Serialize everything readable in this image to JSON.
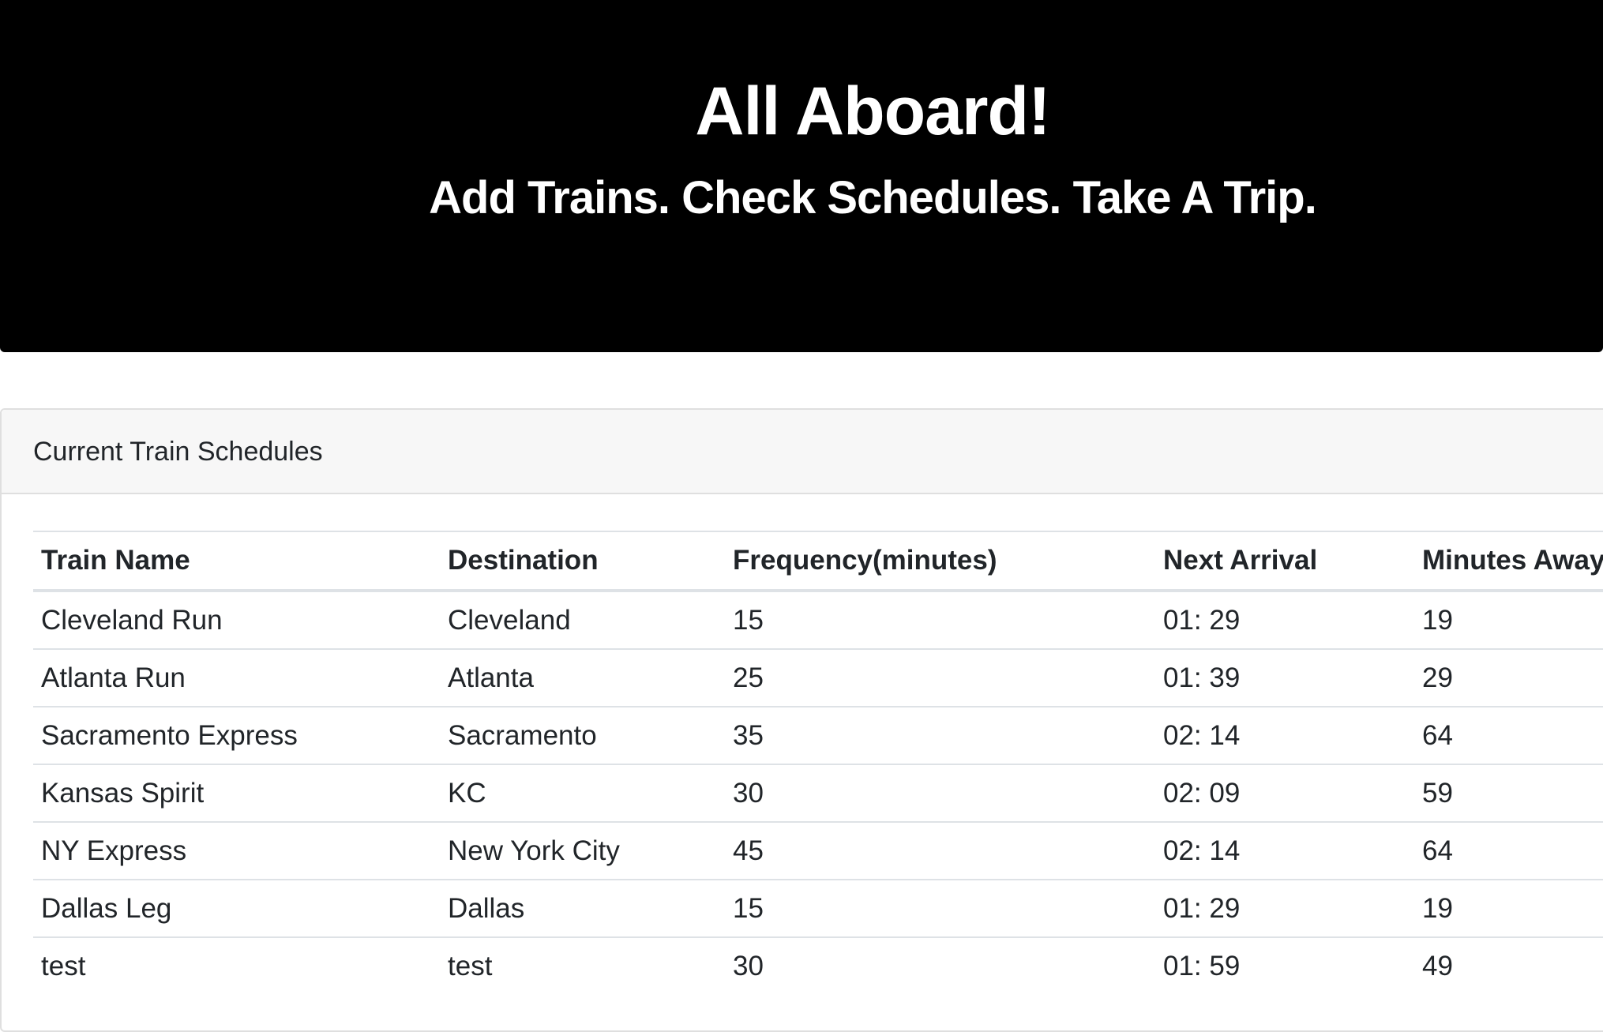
{
  "header": {
    "title": "All Aboard!",
    "subtitle": "Add Trains. Check Schedules. Take A Trip."
  },
  "schedules": {
    "heading": "Current Train Schedules",
    "columns": [
      "Train Name",
      "Destination",
      "Frequency(minutes)",
      "Next Arrival",
      "Minutes Away"
    ],
    "rows": [
      [
        "Cleveland Run",
        "Cleveland",
        "15",
        "01: 29",
        "19"
      ],
      [
        "Atlanta Run",
        "Atlanta",
        "25",
        "01: 39",
        "29"
      ],
      [
        "Sacramento Express",
        "Sacramento",
        "35",
        "02: 14",
        "64"
      ],
      [
        "Kansas Spirit",
        "KC",
        "30",
        "02: 09",
        "59"
      ],
      [
        "NY Express",
        "New York City",
        "45",
        "02: 14",
        "64"
      ],
      [
        "Dallas Leg",
        "Dallas",
        "15",
        "01: 29",
        "19"
      ],
      [
        "test",
        "test",
        "30",
        "01: 59",
        "49"
      ]
    ]
  }
}
